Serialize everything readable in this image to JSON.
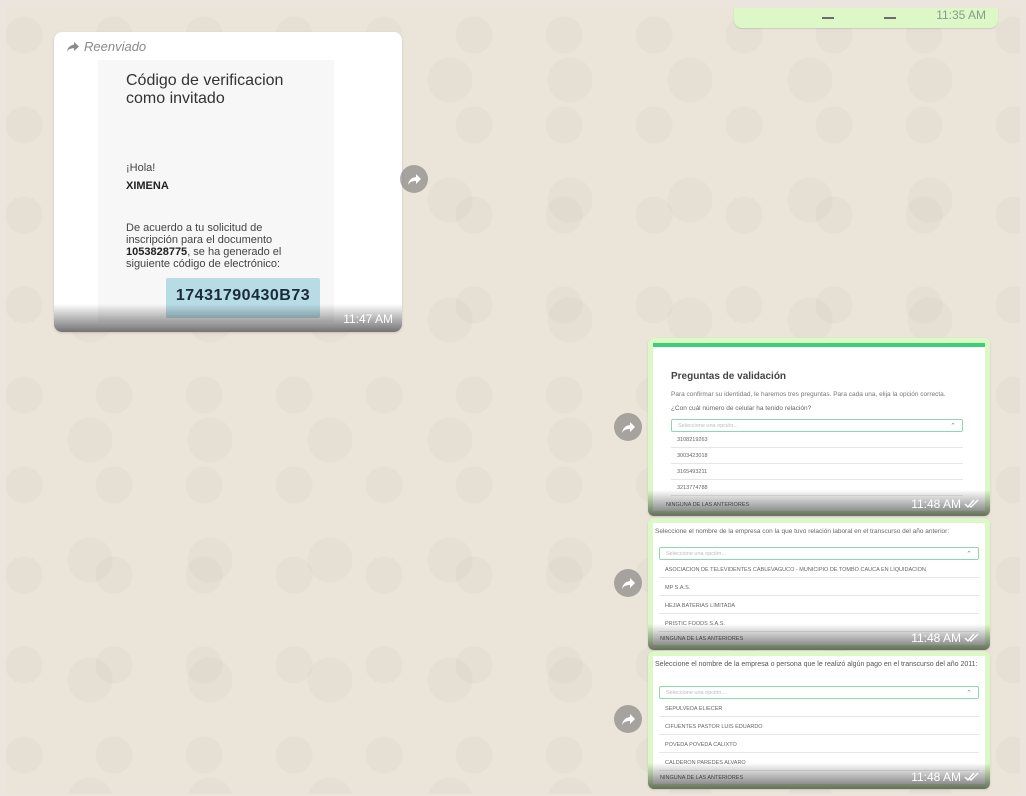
{
  "top_bubble": {
    "time": "11:35 AM"
  },
  "message1": {
    "forwarded_label": "Reenviado",
    "subject": "Código de verificacion como invitado",
    "greeting": "¡Hola!",
    "name": "XIMENA",
    "body_start": "De acuerdo a tu solicitud de inscripción para el documento ",
    "document": "1053828775",
    "body_end": ", se ha generado el siguiente código de electrónico:",
    "code": "17431790430B73",
    "time": "11:47 AM"
  },
  "message2": {
    "title": "Preguntas de validación",
    "description": "Para confirmar su identidad, le haremos tres preguntas. Para cada una, elija la opción correcta.",
    "question": "¿Con cuál número de celular ha tenido relación?",
    "select_placeholder": "Seleccione una opción...",
    "options": [
      "3108219263",
      "3003423018",
      "3165493211",
      "3213774788"
    ],
    "last_option": "NINGUNA DE LAS ANTERIORES",
    "time": "11:48 AM"
  },
  "message3": {
    "question": "Seleccione el nombre de la empresa con la que tuvo relación laboral en el transcurso del año anterior:",
    "select_placeholder": "Seleccione una opción...",
    "options": [
      "ASOCIACION DE TELEVIDENTES CABLEVAGUCO - MUNICIPIO DE TOMBO CAUCA EN LIQUIDACION",
      "MP S.A.S.",
      "HEJIA BATERIAS LIMITADA",
      "PRISTIC FOODS S.A.S."
    ],
    "last_option": "NINGUNA DE LAS ANTERIORES",
    "time": "11:48 AM"
  },
  "message4": {
    "question": "Seleccione el nombre de la empresa o persona que le realizó algún pago en el transcurso del año 2011:",
    "select_placeholder": "Seleccione una opción...",
    "options": [
      "SEPULVEDA ELIECER",
      "CIFUENTES PASTOR LUIS EDUARDO",
      "POVEDA POVEDA CALIXTO",
      "CALDERON PAREDES ALVARO"
    ],
    "last_option": "NINGUNA DE LAS ANTERIORES",
    "time": "11:48 AM"
  }
}
